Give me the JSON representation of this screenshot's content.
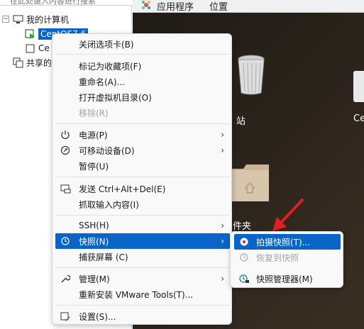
{
  "library": {
    "search_placeholder": "在此处键入内容进行搜索",
    "root_label": "我的计算机",
    "root_expander": "−",
    "vm1_label": "CentOS7.6",
    "vm2_label": "Ce",
    "shared_label": "共享的"
  },
  "desktop": {
    "gnome_apps": "应用程序",
    "gnome_places": "位置",
    "trash_label": "站",
    "partial_label": "Ce",
    "folder_label": "件夹"
  },
  "menu": {
    "items": [
      {
        "label": "关闭选项卡(B)"
      },
      {
        "label": "标记为收藏项(F)"
      },
      {
        "label": "重命名(A)..."
      },
      {
        "label": "打开虚拟机目录(O)"
      },
      {
        "label": "移除(R)"
      },
      {
        "label": "电源(P)"
      },
      {
        "label": "可移动设备(D)"
      },
      {
        "label": "暂停(U)"
      },
      {
        "label": "发送 Ctrl+Alt+Del(E)"
      },
      {
        "label": "抓取输入内容(I)"
      },
      {
        "label": "SSH(H)"
      },
      {
        "label": "快照(N)"
      },
      {
        "label": "捕获屏幕 (C)"
      },
      {
        "label": "管理(M)"
      },
      {
        "label": "重新安装 VMware Tools(T)..."
      },
      {
        "label": "设置(S)..."
      }
    ],
    "submenu_arrow": "›"
  },
  "submenu": {
    "items": [
      {
        "label": "拍摄快照(T)..."
      },
      {
        "label": "恢复到快照"
      },
      {
        "label": "快照管理器(M)"
      }
    ]
  },
  "colors": {
    "highlight": "#0a64c8",
    "annotation_arrow": "#e02020"
  }
}
